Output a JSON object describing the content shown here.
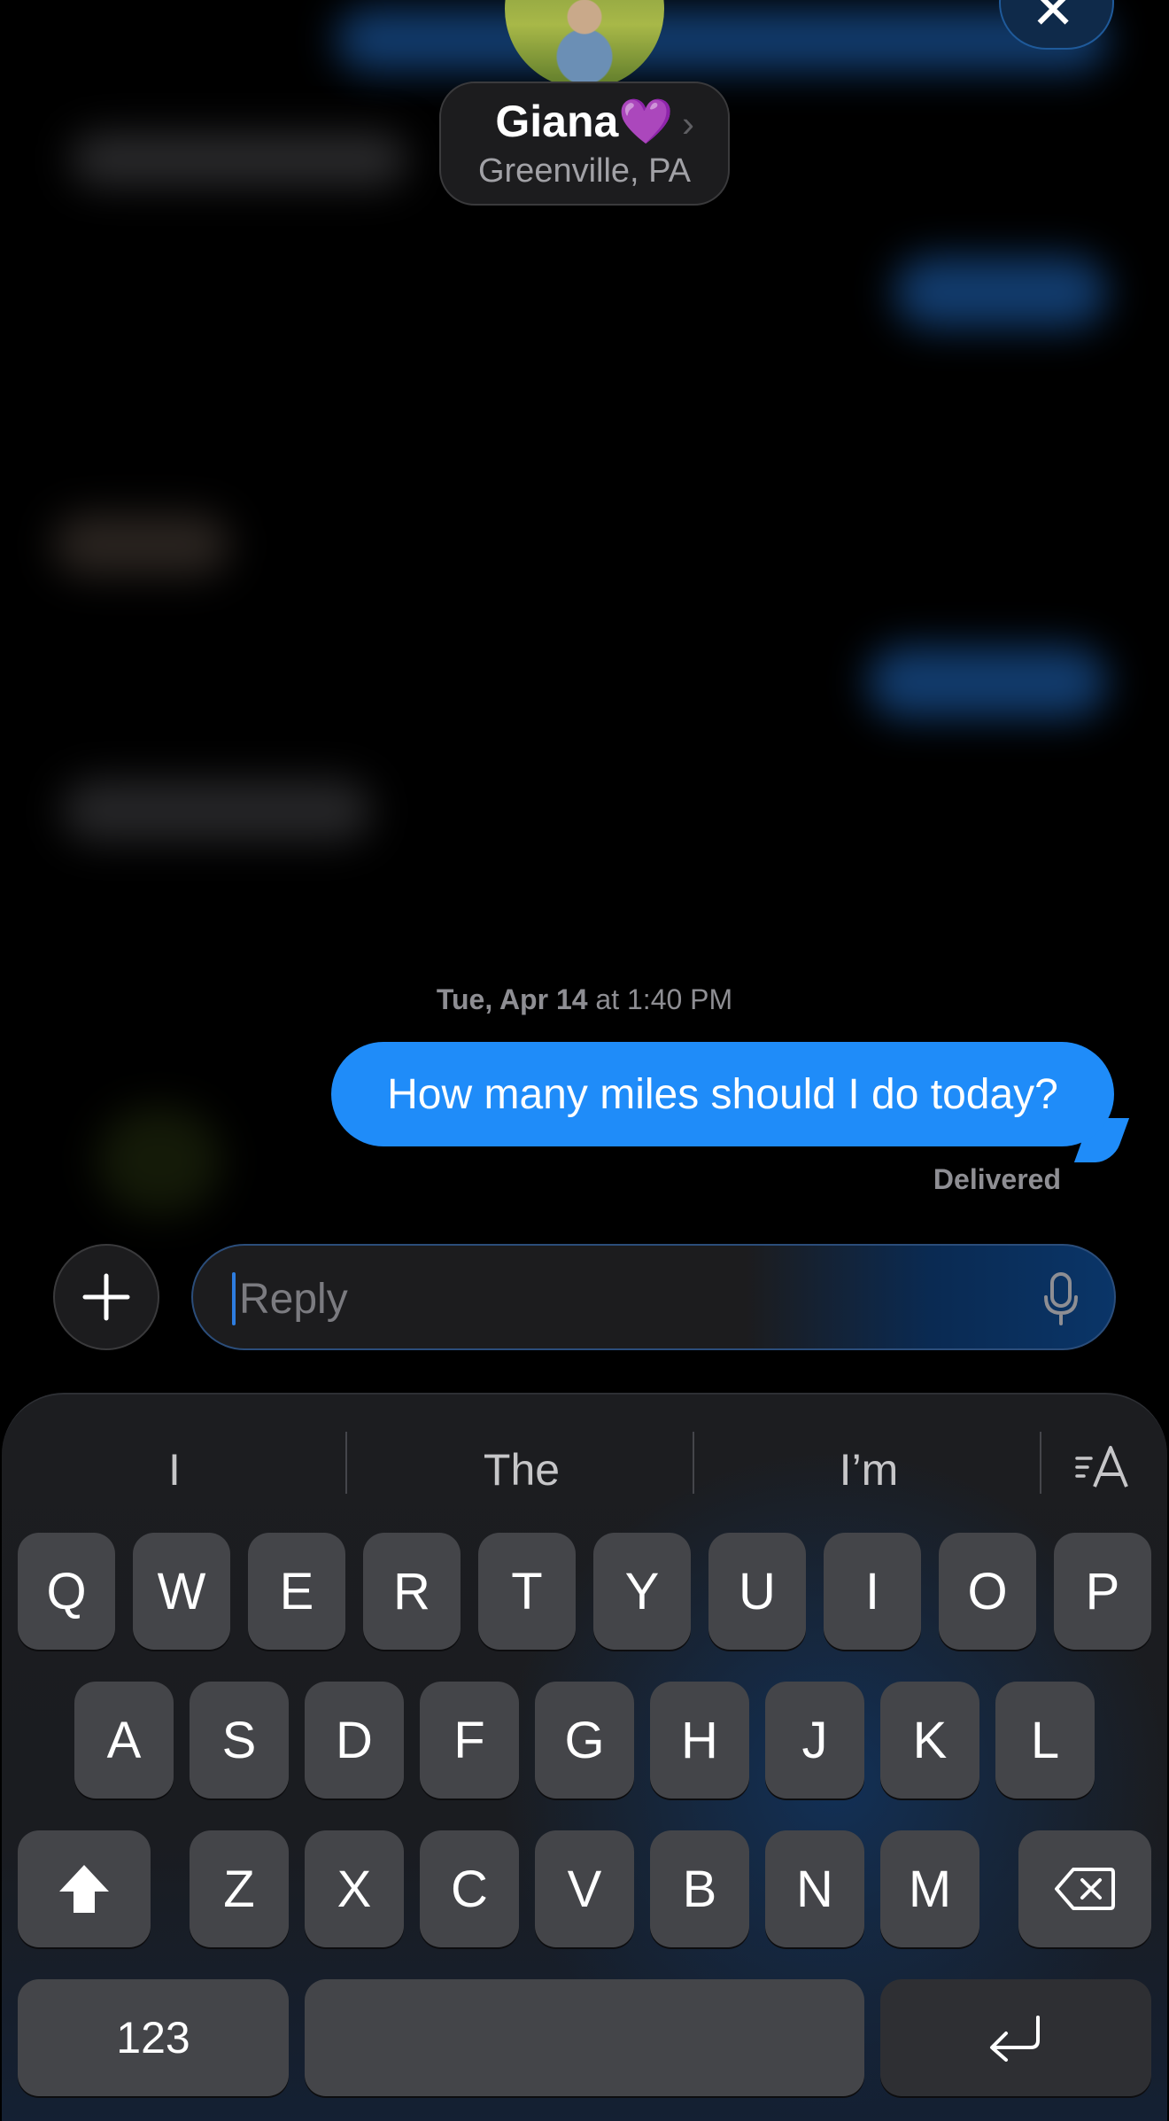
{
  "header": {
    "contact_name": "Giana💜",
    "contact_location": "Greenville, PA",
    "chevron": "›",
    "close_symbol": "✕"
  },
  "thread": {
    "timestamp_day": "Tue, Apr 14",
    "timestamp_time": " at 1:40 PM",
    "message": "How many miles should I do today?",
    "status": "Delivered"
  },
  "compose": {
    "placeholder": "Reply",
    "add_symbol": "+"
  },
  "keyboard": {
    "suggestions": [
      "I",
      "The",
      "I’m"
    ],
    "row1": [
      "Q",
      "W",
      "E",
      "R",
      "T",
      "Y",
      "U",
      "I",
      "O",
      "P"
    ],
    "row2": [
      "A",
      "S",
      "D",
      "F",
      "G",
      "H",
      "J",
      "K",
      "L"
    ],
    "row3": [
      "Z",
      "X",
      "C",
      "V",
      "B",
      "N",
      "M"
    ],
    "numbers_key": "123"
  },
  "colors": {
    "bubble": "#1f8cf9",
    "background": "#000000",
    "key": "#444549"
  }
}
